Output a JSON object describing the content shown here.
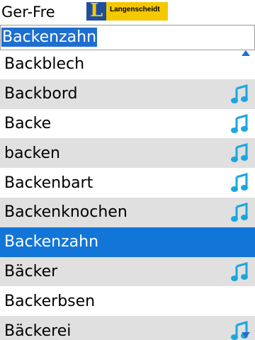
{
  "header": {
    "lang_pair": "Ger-Fre",
    "logo_letter": "L",
    "logo_text": "Langenscheidt"
  },
  "search": {
    "value": "Backenzahn"
  },
  "list": {
    "items": [
      {
        "label": "Backblech",
        "audio": false
      },
      {
        "label": "Backbord",
        "audio": true
      },
      {
        "label": "Backe",
        "audio": true
      },
      {
        "label": "backen",
        "audio": true
      },
      {
        "label": "Backenbart",
        "audio": true
      },
      {
        "label": "Backenknochen",
        "audio": true
      },
      {
        "label": "Backenzahn",
        "audio": false,
        "selected": true
      },
      {
        "label": "Bäcker",
        "audio": true
      },
      {
        "label": "Backerbsen",
        "audio": false
      },
      {
        "label": "Bäckerei",
        "audio": true
      }
    ]
  },
  "colors": {
    "selection": "#1275d8",
    "alt_row": "#e0e0e0",
    "note_icon": "#1aa6df",
    "logo_blue": "#1f4e9e",
    "logo_yellow": "#f6c800"
  }
}
